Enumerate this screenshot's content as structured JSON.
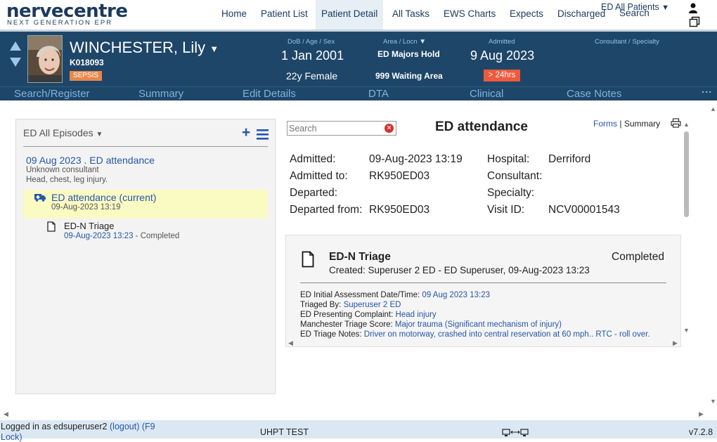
{
  "brand": {
    "name": "nervecentre",
    "tagline": "NEXT GENERATION EPR"
  },
  "nav": [
    {
      "label": "Home"
    },
    {
      "label": "Patient List"
    },
    {
      "label": "Patient Detail"
    },
    {
      "label": "All Tasks"
    },
    {
      "label": "EWS Charts"
    },
    {
      "label": "Expects"
    },
    {
      "label": "Discharged"
    },
    {
      "label": "Search"
    }
  ],
  "patient_list_selector": "ED All Patients",
  "patient": {
    "name": "WINCHESTER, Lily",
    "id": "K018093",
    "alert_badge": "SEPSIS",
    "dob_label": "DoB / Age / Sex",
    "dob": "1 Jan 2001",
    "age_sex": "22y Female",
    "area_label": "Area / Locn",
    "area": "ED Majors Hold",
    "location": "999 Waiting Area",
    "admitted_label": "Admitted",
    "admitted": "9 Aug 2023",
    "admitted_badge": "> 24hrs",
    "consultant_label": "Consultant / Specialty"
  },
  "tabs": [
    {
      "label": "Search/Register"
    },
    {
      "label": "Summary"
    },
    {
      "label": "Edit Details"
    },
    {
      "label": "DTA"
    },
    {
      "label": "Clinical"
    },
    {
      "label": "Case Notes"
    }
  ],
  "tabs_more": "···",
  "episodes": {
    "header": "ED All Episodes",
    "episode": {
      "title": "09 Aug 2023 . ED attendance",
      "consultant": "Unknown consultant",
      "complaint": "Head, chest, leg injury."
    },
    "attendance": {
      "title": "ED attendance (current)",
      "time": "09-Aug-2023 13:19"
    },
    "form": {
      "title": "ED-N Triage",
      "time": "09-Aug-2023 13:23",
      "status": "- Completed"
    }
  },
  "detail": {
    "search_placeholder": "Search",
    "title": "ED attendance",
    "forms_link": "Forms",
    "separator": "|",
    "summary_link": "Summary",
    "fields": {
      "admitted_label": "Admitted:",
      "admitted": "09-Aug-2023 13:19",
      "admitted_to_label": "Admitted to:",
      "admitted_to": "RK950ED03",
      "departed_label": "Departed:",
      "departed": "",
      "departed_from_label": "Departed from:",
      "departed_from": "RK950ED03",
      "hospital_label": "Hospital:",
      "hospital": "Derriford",
      "consultant_label": "Consultant:",
      "consultant": "",
      "specialty_label": "Specialty:",
      "specialty": "",
      "visit_id_label": "Visit ID:",
      "visit_id": "NCV00001543"
    },
    "triage": {
      "title": "ED-N Triage",
      "status": "Completed",
      "created": "Created: Superuser 2 ED - ED Superuser, 09-Aug-2023 13:23",
      "rows": [
        {
          "label": "ED Initial Assessment Date/Time:",
          "value": "09 Aug 2023 13:23"
        },
        {
          "label": "Triaged By:",
          "value": "Superuser 2 ED"
        },
        {
          "label": "ED Presenting Complaint:",
          "value": "Head injury"
        },
        {
          "label": "Manchester Triage Score:",
          "value": "Major trauma (Significant mechanism of injury)"
        },
        {
          "label": "ED Triage Notes:",
          "value": "Driver on motorway, crashed into central reservation at 60 mph.. RTC - roll over."
        }
      ]
    }
  },
  "footer": {
    "logged_in_prefix": "Logged in as edsuperuser2",
    "logout": "(logout)",
    "lock_hint": "(F9",
    "lock_word": "Lock)",
    "environment": "UHPT TEST",
    "version": "v7.2.8"
  },
  "colors": {
    "header_bg": "#1e4668",
    "badge_orange": "#e8884b",
    "badge_red": "#f05a3c",
    "link_blue": "#2456a8",
    "highlight": "#fafac3"
  }
}
